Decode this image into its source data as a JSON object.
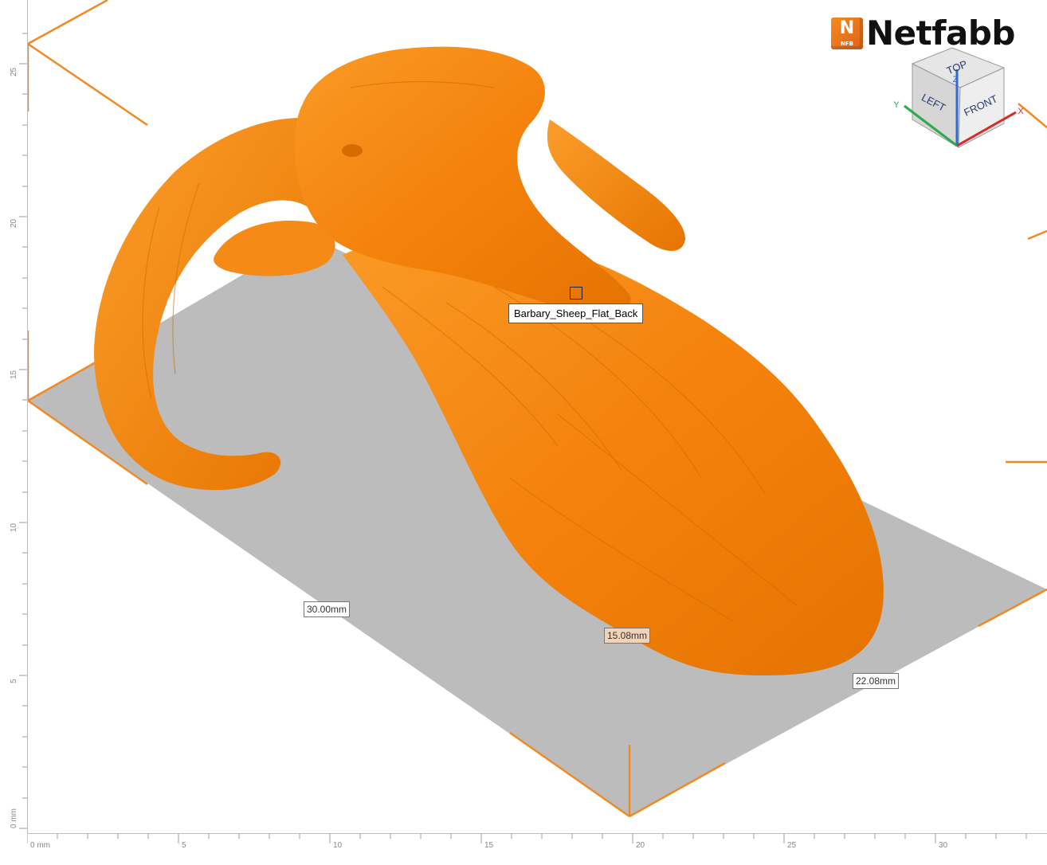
{
  "app": {
    "brand_name": "Netfabb",
    "brand_badge_letter": "N",
    "brand_badge_sub": "NFB"
  },
  "part": {
    "name": "Barbary_Sheep_Flat_Back",
    "color": "#f7870f"
  },
  "dimensions": {
    "x_label": "30.00mm",
    "z_label": "15.08mm",
    "y_label": "22.08mm"
  },
  "build_plate": {
    "color": "#bcbcbc",
    "outline_color": "#f08a24"
  },
  "view_cube": {
    "top": "TOP",
    "left": "LEFT",
    "front": "FRONT",
    "axis_x": "X",
    "axis_y": "Y",
    "axis_z": "Z",
    "axis_x_color": "#d62b2b",
    "axis_y_color": "#2fa84f",
    "axis_z_color": "#2e6bd6"
  },
  "ruler_bottom": {
    "ticks": [
      "0 mm",
      "5",
      "10",
      "15",
      "20",
      "25",
      "30"
    ]
  },
  "ruler_left": {
    "ticks": [
      "0 mm",
      "5",
      "10",
      "15",
      "20",
      "25"
    ]
  }
}
